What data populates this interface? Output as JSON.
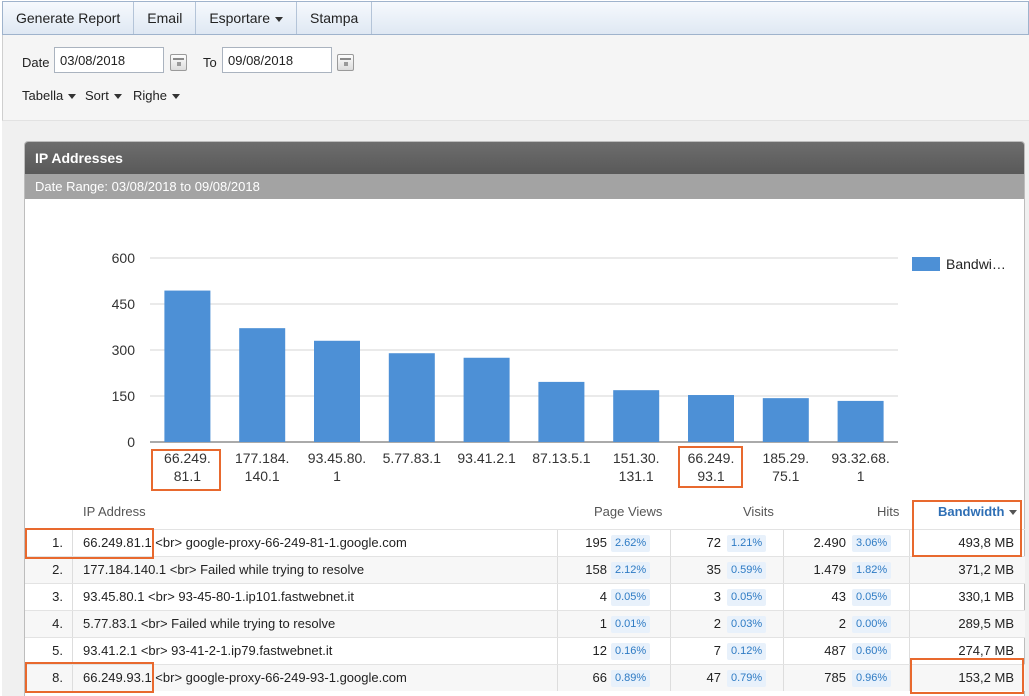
{
  "toolbar": {
    "items": [
      {
        "label": "Generate Report"
      },
      {
        "label": "Email"
      },
      {
        "label": "Esportare"
      },
      {
        "label": "Stampa"
      }
    ]
  },
  "filters": {
    "date_label": "Date",
    "date_from": "03/08/2018",
    "to_label": "To",
    "date_to": "09/08/2018",
    "menus": [
      {
        "label": "Tabella"
      },
      {
        "label": "Sort"
      },
      {
        "label": "Righe"
      }
    ]
  },
  "report": {
    "title": "IP Addresses",
    "subtitle": "Date Range: 03/08/2018 to 09/08/2018"
  },
  "chart_data": {
    "type": "bar",
    "categories": [
      "66.249.81.1",
      "177.184.140.1",
      "93.45.80.1",
      "5.77.83.1",
      "93.41.2.1",
      "87.13.5.1",
      "151.30.131.1",
      "66.249.93.1",
      "185.29.75.1",
      "93.32.68.1"
    ],
    "category_lines": [
      [
        "66.249.",
        "81.1"
      ],
      [
        "177.184.",
        "140.1"
      ],
      [
        "93.45.80.",
        "1"
      ],
      [
        "5.77.83.1"
      ],
      [
        "93.41.2.1"
      ],
      [
        "87.13.5.1"
      ],
      [
        "151.30.",
        "131.1"
      ],
      [
        "66.249.",
        "93.1"
      ],
      [
        "185.29.",
        "75.1"
      ],
      [
        "93.32.68.",
        "1"
      ]
    ],
    "series": [
      {
        "name": "Bandwi…",
        "values": [
          493.8,
          371.2,
          330.1,
          289.5,
          274.7,
          196,
          169,
          153.2,
          143,
          134
        ]
      }
    ],
    "ylim": [
      0,
      600
    ],
    "yticks": [
      "0",
      "150",
      "300",
      "450",
      "600"
    ],
    "grid": true,
    "legend": "right",
    "color": "#4d90d6"
  },
  "table": {
    "headers": {
      "ip": "IP Address",
      "page_views": "Page Views",
      "visits": "Visits",
      "hits": "Hits",
      "bandwidth": "Bandwidth"
    },
    "rows": [
      {
        "rank": "1.",
        "ip": "66.249.81.1 <br> google-proxy-66-249-81-1.google.com",
        "pv": "195",
        "pv_pct": "2.62%",
        "visits": "72",
        "visits_pct": "1.21%",
        "hits": "2.490",
        "hits_pct": "3.06%",
        "bw": "493,8 MB"
      },
      {
        "rank": "2.",
        "ip": "177.184.140.1 <br> Failed while trying to resolve",
        "pv": "158",
        "pv_pct": "2.12%",
        "visits": "35",
        "visits_pct": "0.59%",
        "hits": "1.479",
        "hits_pct": "1.82%",
        "bw": "371,2 MB"
      },
      {
        "rank": "3.",
        "ip": "93.45.80.1 <br> 93-45-80-1.ip101.fastwebnet.it",
        "pv": "4",
        "pv_pct": "0.05%",
        "visits": "3",
        "visits_pct": "0.05%",
        "hits": "43",
        "hits_pct": "0.05%",
        "bw": "330,1 MB"
      },
      {
        "rank": "4.",
        "ip": "5.77.83.1 <br> Failed while trying to resolve",
        "pv": "1",
        "pv_pct": "0.01%",
        "visits": "2",
        "visits_pct": "0.03%",
        "hits": "2",
        "hits_pct": "0.00%",
        "bw": "289,5 MB"
      },
      {
        "rank": "5.",
        "ip": "93.41.2.1 <br> 93-41-2-1.ip79.fastwebnet.it",
        "pv": "12",
        "pv_pct": "0.16%",
        "visits": "7",
        "visits_pct": "0.12%",
        "hits": "487",
        "hits_pct": "0.60%",
        "bw": "274,7 MB"
      },
      {
        "rank": "8.",
        "ip": "66.249.93.1 <br> google-proxy-66-249-93-1.google.com",
        "pv": "66",
        "pv_pct": "0.89%",
        "visits": "47",
        "visits_pct": "0.79%",
        "hits": "785",
        "hits_pct": "0.96%",
        "bw": "153,2 MB"
      }
    ]
  }
}
